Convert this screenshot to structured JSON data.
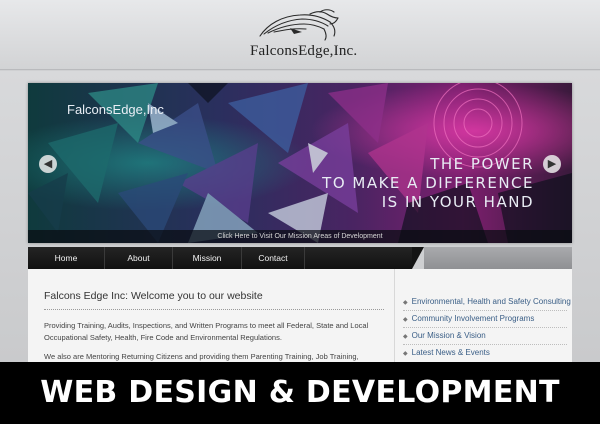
{
  "header": {
    "logo_text": "FalconsEdge,Inc.",
    "logo_icon": "falcon-icon"
  },
  "slider": {
    "brand": "FalconsEdge,Inc",
    "tagline": [
      "THE POWER",
      "TO MAKE A DIFFERENCE",
      "IS IN YOUR HAND"
    ],
    "caption": "Click Here to Visit Our Mission Areas of Development",
    "prev_icon": "arrow-left-icon",
    "next_icon": "arrow-right-icon"
  },
  "nav": {
    "items": [
      "Home",
      "About",
      "Mission",
      "Contact"
    ]
  },
  "main": {
    "title": "Falcons Edge Inc: Welcome you to our website",
    "paragraph1": "Providing Training, Audits, Inspections, and Written Programs to meet all Federal, State and Local Occupational Safety, Health, Fire Code and Environmental Regulations.",
    "paragraph2": "We also are Mentoring Returning Citizens and providing them Parenting Training, Job Training,  HIV/AIDS"
  },
  "sidebar": {
    "links": [
      "Environmental, Health and Safety Consulting",
      "Community Involvement Programs",
      "Our Mission & Vision",
      "Latest News & Events"
    ]
  },
  "banner": {
    "text": "WEB DESIGN & DEVELOPMENT"
  },
  "colors": {
    "banner_bg": "#000000",
    "nav_bg": "#1a1a1a",
    "sidebar_link": "#3a5e86",
    "slider_accent": "#c0369a"
  }
}
